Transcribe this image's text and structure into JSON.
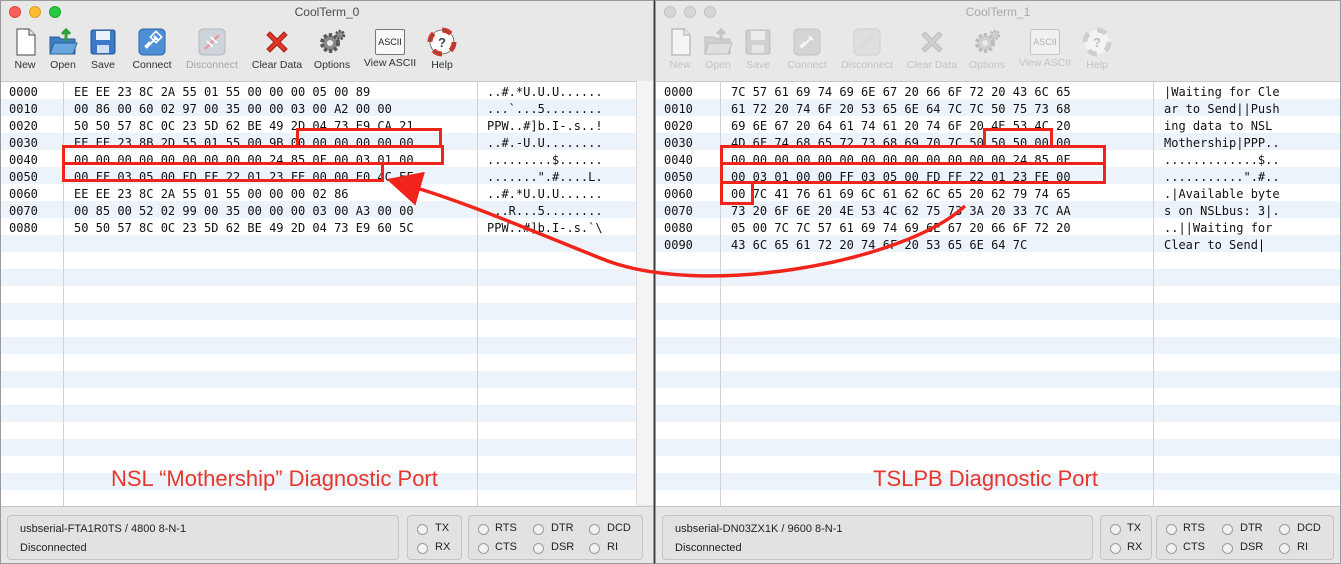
{
  "windows": [
    {
      "title": "CoolTerm_0",
      "toolbar": {
        "new": "New",
        "open": "Open",
        "save": "Save",
        "connect": "Connect",
        "disconnect": "Disconnect",
        "clear_data": "Clear Data",
        "options": "Options",
        "view_ascii": "View ASCII",
        "help": "Help",
        "ascii_badge": "ASCII"
      },
      "addresses": "0000\n0010\n0020\n0030\n0040\n0050\n0060\n0070\n0080",
      "hex": "EE EE 23 8C 2A 55 01 55 00 00 00 05 00 89\n00 86 00 60 02 97 00 35 00 00 03 00 A2 00 00\n50 50 57 8C 0C 23 5D 62 BE 49 2D 04 73 E9 CA 21\nEE EE 23 8B 2D 55 01 55 00 9B 00 00 00 00 00 00\n00 00 00 00 00 00 00 00 00 24 85 0F 00 03 01 00\n00 FF 03 05 00 FD FF 22 01 23 FE 00 00 E0 4C EF\nEE EE 23 8C 2A 55 01 55 00 00 00 02 86\n00 85 00 52 02 99 00 35 00 00 00 03 00 A3 00 00\n50 50 57 8C 0C 23 5D 62 BE 49 2D 04 73 E9 60 5C",
      "ascii": "..#.*U.U.U......\n...`...5........\nPPW..#]b.I-.s..!\n..#.-U.U........\n.........$......\n.......\".#....L.\n..#.*U.U.U......\n...R...5........\nPPW..#]b.I-.s.`\\",
      "caption": "NSL “Mothership” Diagnostic Port",
      "port_line": "usbserial-FTA1R0TS / 4800 8-N-1",
      "state": "Disconnected",
      "leds": {
        "tx": "TX",
        "rx": "RX",
        "rts": "RTS",
        "cts": "CTS",
        "dtr": "DTR",
        "dsr": "DSR",
        "dcd": "DCD",
        "ri": "RI"
      }
    },
    {
      "title": "CoolTerm_1",
      "toolbar": {
        "new": "New",
        "open": "Open",
        "save": "Save",
        "connect": "Connect",
        "disconnect": "Disconnect",
        "clear_data": "Clear Data",
        "options": "Options",
        "view_ascii": "View ASCII",
        "help": "Help",
        "ascii_badge": "ASCII"
      },
      "addresses": "0000\n0010\n0020\n0030\n0040\n0050\n0060\n0070\n0080\n0090",
      "hex": "7C 57 61 69 74 69 6E 67 20 66 6F 72 20 43 6C 65\n61 72 20 74 6F 20 53 65 6E 64 7C 7C 50 75 73 68\n69 6E 67 20 64 61 74 61 20 74 6F 20 4E 53 4C 20\n4D 6F 74 68 65 72 73 68 69 70 7C 50 50 50 00 00\n00 00 00 00 00 00 00 00 00 00 00 00 00 24 85 0F\n00 03 01 00 00 FF 03 05 00 FD FF 22 01 23 FE 00\n00 7C 41 76 61 69 6C 61 62 6C 65 20 62 79 74 65\n73 20 6F 6E 20 4E 53 4C 62 75 73 3A 20 33 7C AA\n05 00 7C 7C 57 61 69 74 69 6E 67 20 66 6F 72 20\n43 6C 65 61 72 20 74 6F 20 53 65 6E 64 7C",
      "ascii": "|Waiting for Cle\nar to Send||Push\ning data to NSL \nMothership|PPP..\n.............$..\n...........\".#..\n.|Available byte\ns on NSLbus: 3|.\n..||Waiting for \nClear to Send|",
      "caption": "TSLPB Diagnostic Port",
      "port_line": "usbserial-DN03ZX1K / 9600 8-N-1",
      "state": "Disconnected",
      "leds": {
        "tx": "TX",
        "rx": "RX",
        "rts": "RTS",
        "cts": "CTS",
        "dtr": "DTR",
        "dsr": "DSR",
        "dcd": "DCD",
        "ri": "RI"
      }
    }
  ],
  "annotation_color": "#f0241a"
}
